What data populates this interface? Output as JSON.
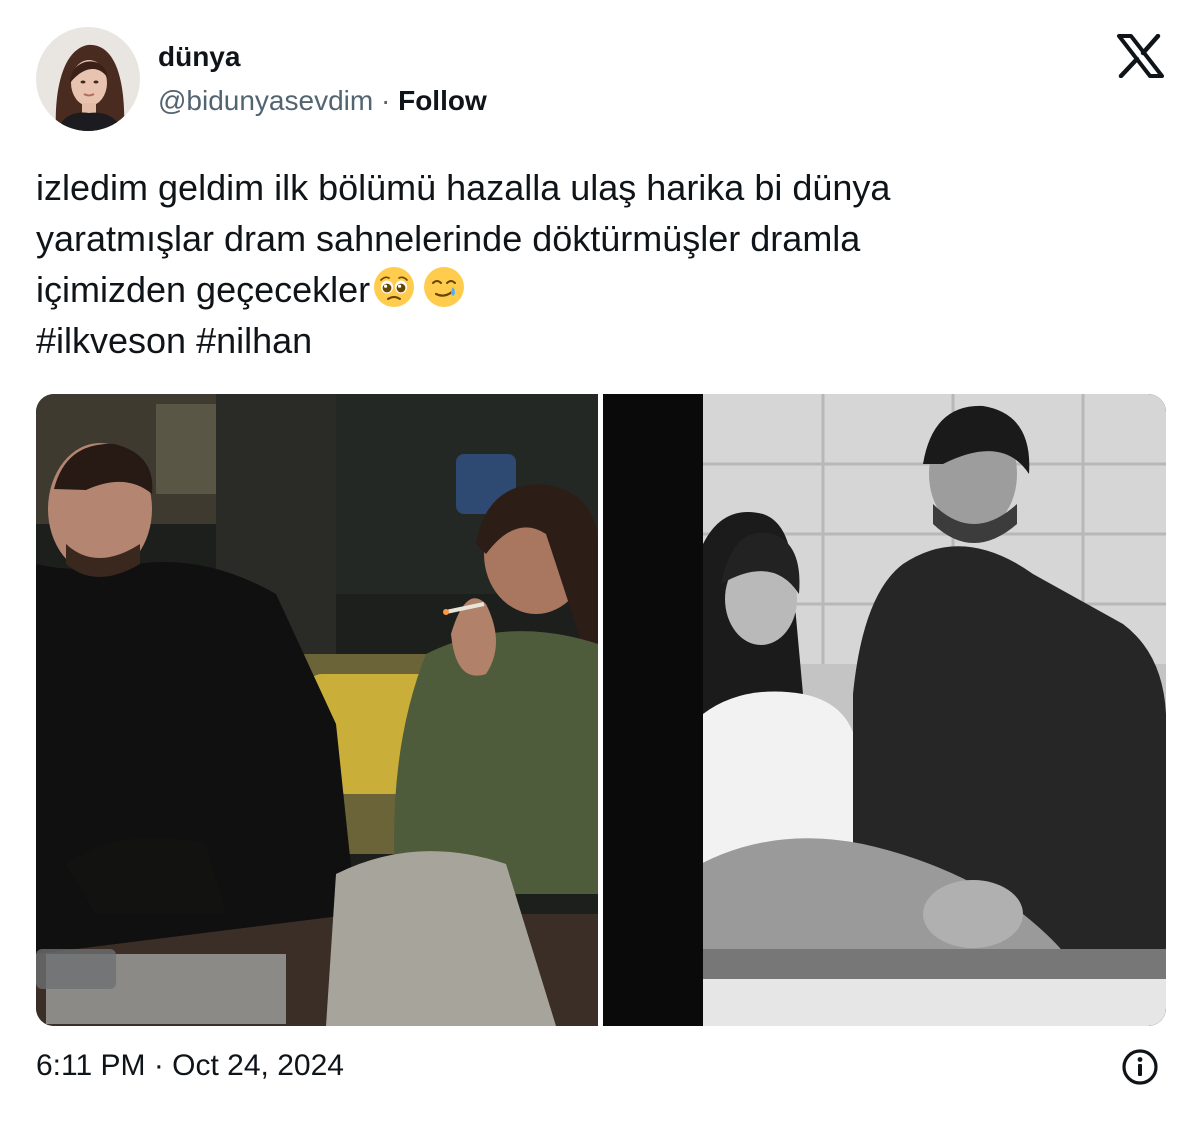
{
  "author": {
    "display_name": "dünya",
    "handle": "@bidunyasevdim",
    "separator": " · ",
    "follow_label": "Follow"
  },
  "brand": {
    "logo_icon": "x-logo-icon",
    "color": "#0f1419"
  },
  "tweet": {
    "lines": [
      "izledim geldim ilk bölümü hazalla ulaş harika bi dünya",
      "yaratmışlar dram sahnelerinde döktürmüşler dramla",
      "içimizden geçecekler",
      "#ilkveson #nilhan"
    ],
    "emojis": [
      "pleading-face-emoji",
      "smiling-face-with-tear-emoji"
    ]
  },
  "media": {
    "photos": [
      {
        "icon": "photo-couple-living-room",
        "tone": "color"
      },
      {
        "icon": "photo-couple-with-dog-bw",
        "tone": "black-and-white"
      }
    ]
  },
  "footer": {
    "time": "6:11 PM",
    "separator": " · ",
    "date": "Oct 24, 2024",
    "info_icon": "info-icon"
  },
  "colors": {
    "text_primary": "#0f1419",
    "text_secondary": "#536471",
    "background": "#ffffff"
  }
}
